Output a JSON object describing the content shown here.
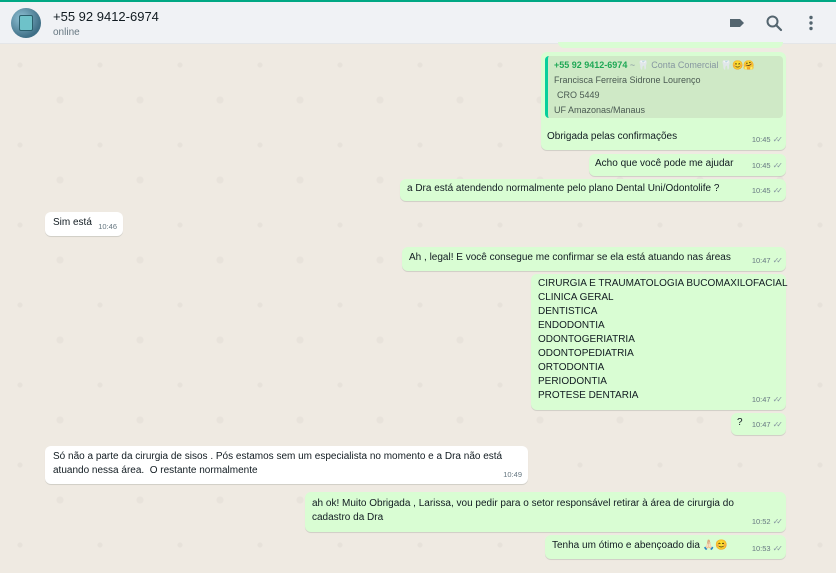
{
  "header": {
    "contact_name": "+55 92 9412-6974",
    "status": "online",
    "icons": [
      "label-icon",
      "search-icon",
      "menu-icon"
    ]
  },
  "colors": {
    "outgoing_bubble": "#d9fdd3",
    "incoming_bubble": "#ffffff",
    "accent": "#00a884",
    "background": "#efeae2"
  },
  "messages": {
    "m1": {
      "quote_sender": "+55 92 9412-6974",
      "quote_sender_sub": "~ 🦷 Conta Comercial 🦷😊🤗",
      "quote_lines": [
        "Francisca Ferreira Sidrone Lourenço",
        "CRO 5449",
        "UF Amazonas/Manaus"
      ],
      "text": "Obrigada pelas confirmações",
      "time": "10:45"
    },
    "m2": {
      "text": "Acho que você pode me ajudar",
      "time": "10:45"
    },
    "m3": {
      "text": "a Dra está atendendo normalmente pelo plano Dental Uni/Odontolife ?",
      "time": "10:45"
    },
    "m4": {
      "text": "Sim está",
      "time": "10:46"
    },
    "m5": {
      "text": "Ah , legal! E você consegue me confirmar se ela está atuando nas áreas",
      "time": "10:47"
    },
    "m6": {
      "lines": [
        "CIRURGIA E TRAUMATOLOGIA BUCOMAXILOFACIAL",
        "CLINICA GERAL",
        "DENTISTICA",
        "ENDODONTIA",
        "ODONTOGERIATRIA",
        "ODONTOPEDIATRIA",
        "ORTODONTIA",
        "PERIODONTIA",
        "PROTESE DENTARIA"
      ],
      "time": "10:47"
    },
    "m7": {
      "text": "?",
      "time": "10:47"
    },
    "m8": {
      "lines": [
        "Só não a parte da cirurgia de sisos . Pós estamos sem um especialista no momento e a Dra não está",
        "atuando nessa área.  O restante normalmente"
      ],
      "time": "10:49"
    },
    "m9": {
      "lines": [
        "ah ok! Muito Obrigada , Larissa, vou pedir para o setor responsável retirar à área de cirurgia do",
        "cadastro da Dra"
      ],
      "time": "10:52"
    },
    "m10": {
      "text": "Tenha um ótimo e abençoado dia 🙏🏻😊",
      "time": "10:53"
    }
  }
}
